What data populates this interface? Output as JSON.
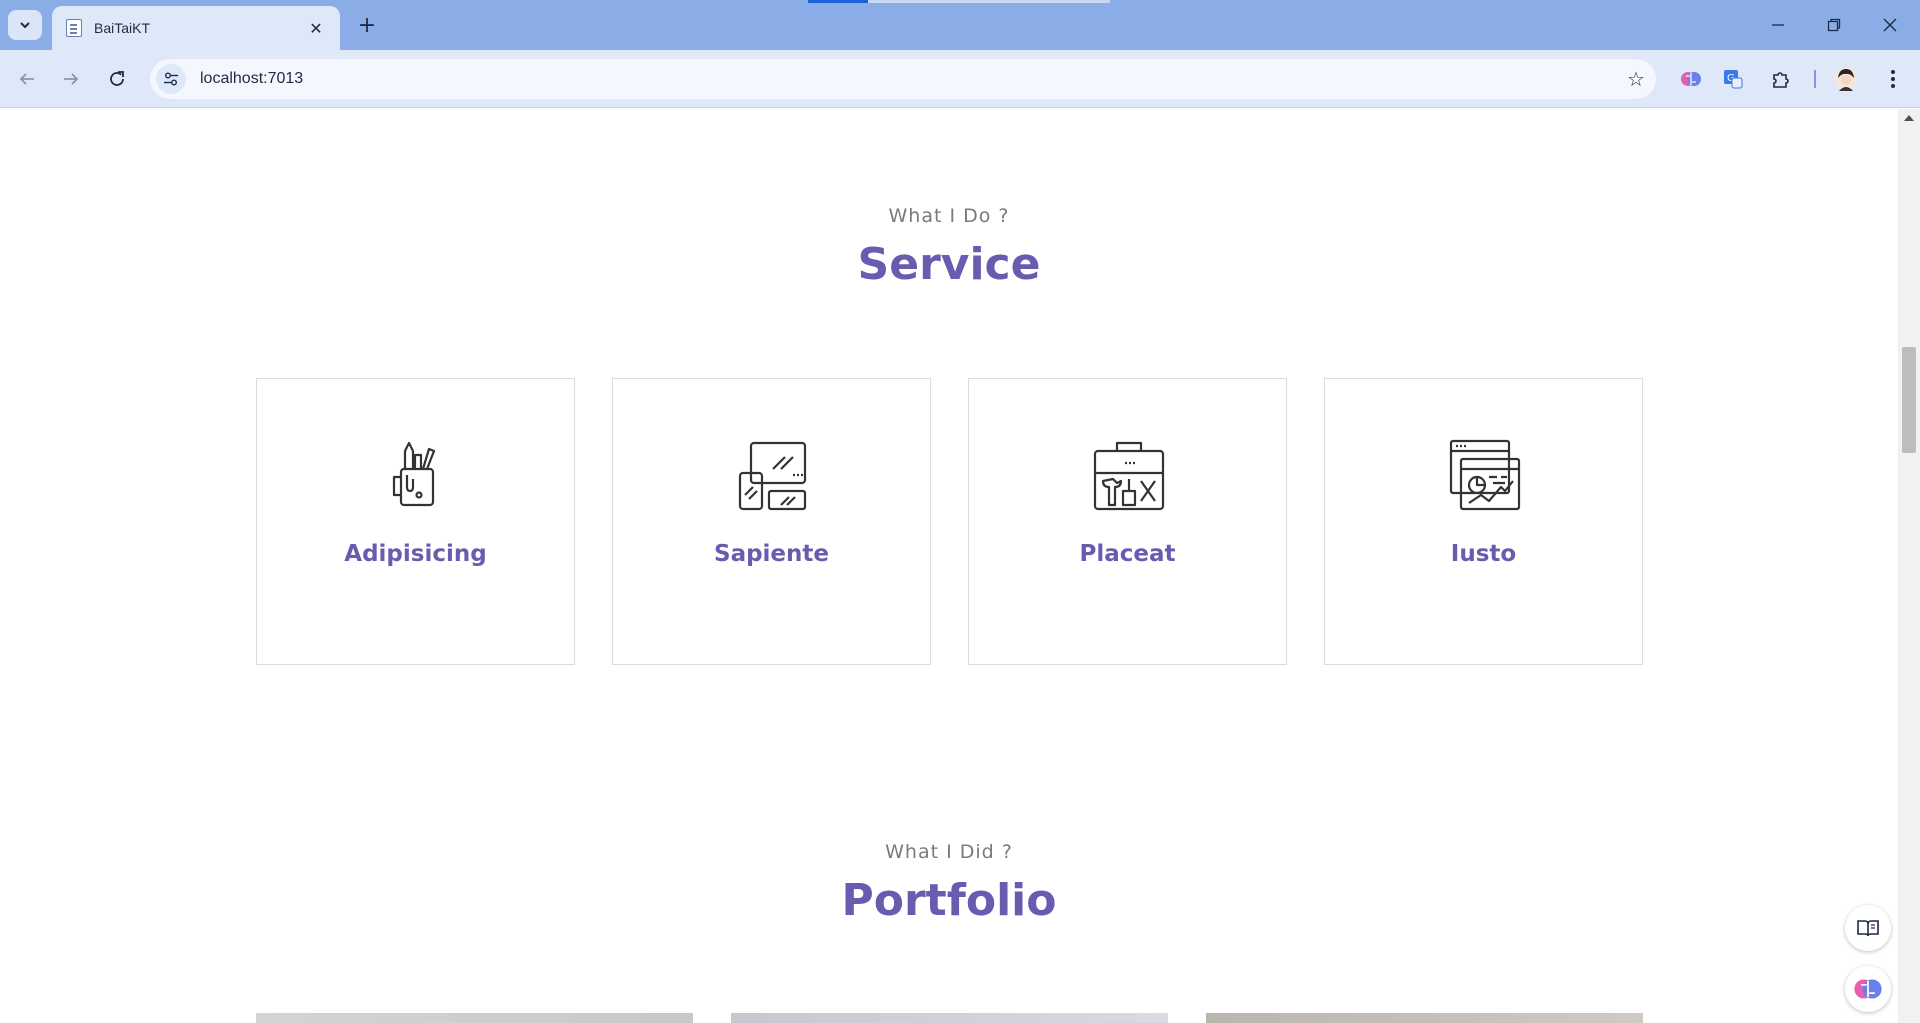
{
  "browser": {
    "tab_title": "BaiTaiKT",
    "url": "localhost:7013",
    "new_tab_glyph": "+",
    "close_glyph": "✕"
  },
  "service": {
    "subtitle": "What I Do ?",
    "title": "Service",
    "cards": [
      {
        "label": "Adipisicing",
        "icon": "pen-mug-icon"
      },
      {
        "label": "Sapiente",
        "icon": "devices-icon"
      },
      {
        "label": "Placeat",
        "icon": "toolbox-icon"
      },
      {
        "label": "Iusto",
        "icon": "analytics-window-icon"
      }
    ]
  },
  "portfolio": {
    "subtitle": "What I Did ?",
    "title": "Portfolio"
  },
  "colors": {
    "accent": "#6a5bb0",
    "tabbar": "#8aade8",
    "toolbar": "#dfe8f8"
  }
}
